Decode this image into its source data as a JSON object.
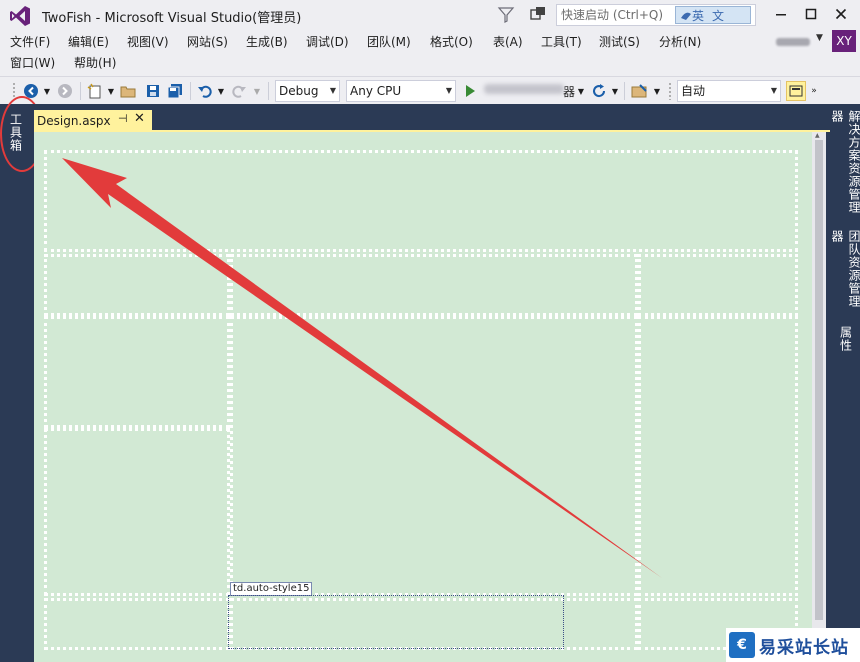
{
  "window": {
    "title": "TwoFish - Microsoft Visual Studio(管理员)",
    "quick_launch_placeholder": "快速启动 (Ctrl+Q)",
    "ime_label": "英文",
    "user_initials": "XY"
  },
  "menu": {
    "row1": [
      "文件(F)",
      "编辑(E)",
      "视图(V)",
      "网站(S)",
      "生成(B)",
      "调试(D)",
      "团队(M)",
      "格式(O)",
      "表(A)",
      "工具(T)",
      "测试(S)",
      "分析(N)"
    ],
    "row2": [
      "窗口(W)",
      "帮助(H)"
    ]
  },
  "toolbar": {
    "configuration": "Debug",
    "platform": "Any CPU",
    "start_suffix": "器",
    "target_schema": "自动"
  },
  "left_panel": {
    "toolbox_label": "工具箱"
  },
  "editor": {
    "tab_title": "Design.aspx",
    "selected_tag": "td.auto-style15"
  },
  "right_panel": {
    "tabs": [
      "解决方案资源管理器",
      "团队资源管理器",
      "属性"
    ]
  },
  "watermark": {
    "title": "易采站长站"
  },
  "colors": {
    "accent_purple": "#68217a",
    "design_surface": "#d2e9d4",
    "tab_yellow": "#fff29d",
    "annotation_red": "#e23b3b",
    "dark_chrome": "#2b3a55"
  }
}
